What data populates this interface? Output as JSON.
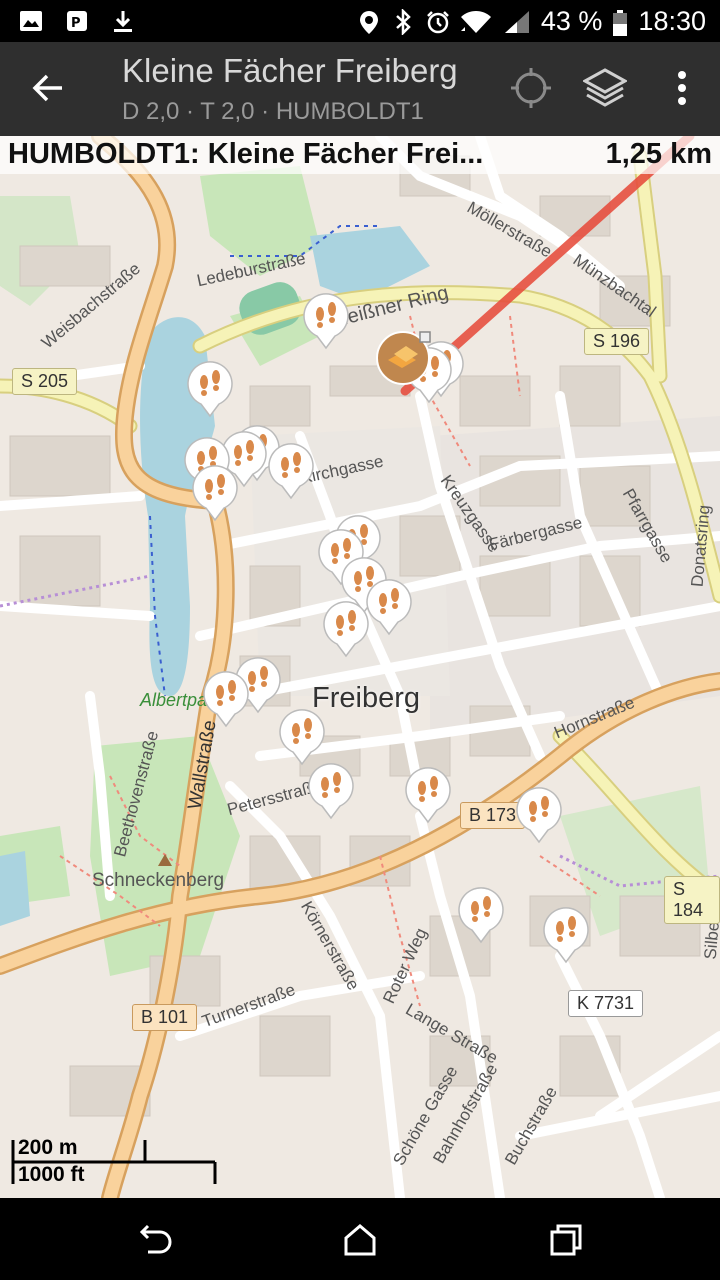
{
  "status_bar": {
    "battery": "43 %",
    "time": "18:30"
  },
  "toolbar": {
    "title": "Kleine Fächer Freiberg",
    "subtitle": "D 2,0 · T 2,0 · HUMBOLDT1"
  },
  "target": {
    "name": "HUMBOLDT1: Kleine Fächer Frei...",
    "distance": "1,25 km"
  },
  "map": {
    "city_label": "Freiberg",
    "street_labels": [
      "Meißner Ring",
      "Ledeburstraße",
      "Weisbachstraße",
      "Kirchgasse",
      "Kreuzgasse",
      "Färbergasse",
      "Pfarrgasse",
      "Münzbachtal",
      "Möllerstraße",
      "Wallstraße",
      "Petersstraße",
      "Beethovenstraße",
      "Schneckenberg",
      "Körnerstraße",
      "Turnerstraße",
      "Roter Weg",
      "Lange Straße",
      "Schöne Gasse",
      "Bahnhofstraße",
      "Buchstraße",
      "Hornstraße",
      "Albertpark",
      "Donatsring",
      "Silberhof"
    ],
    "road_badges": [
      "S 205",
      "S 196",
      "B 173",
      "S 184",
      "B 101",
      "K 7731"
    ],
    "scale": {
      "metric": "200 m",
      "imperial": "1000 ft"
    },
    "colors": {
      "route_line": "#e74c3c",
      "road_major": "#f4c78a",
      "road_secondary": "#f6f6b4",
      "water": "#aad3df",
      "park": "#c8e6b9",
      "pin_fill": "#d9894a"
    }
  }
}
